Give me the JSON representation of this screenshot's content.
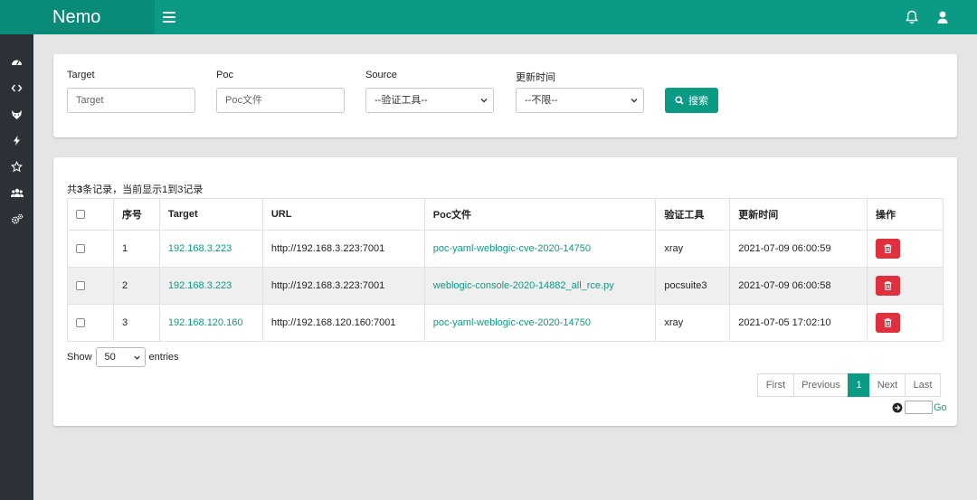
{
  "app": {
    "brand": "Nemo",
    "accent": "#0b9b84",
    "sidebar_bg": "#2b3136",
    "danger": "#e0303e"
  },
  "topbar": {
    "menu_icon": "hamburger-icon",
    "notification_icon": "bell-icon",
    "user_icon": "user-icon"
  },
  "sidebar": {
    "items": [
      {
        "icon": "dashboard-icon"
      },
      {
        "icon": "code-icon"
      },
      {
        "icon": "fox-icon"
      },
      {
        "icon": "bolt-icon"
      },
      {
        "icon": "star-icon"
      },
      {
        "icon": "users-icon"
      },
      {
        "icon": "gears-icon"
      }
    ]
  },
  "search": {
    "target_label": "Target",
    "target_placeholder": "Target",
    "poc_label": "Poc",
    "poc_placeholder": "Poc文件",
    "source_label": "Source",
    "source_selected": "--验证工具--",
    "time_label": "更新时间",
    "time_selected": "--不限--",
    "button_label": "搜索"
  },
  "table": {
    "summary_prefix": "共",
    "summary_count": "3",
    "summary_suffix": "条记录，当前显示1到3记录",
    "headers": [
      "",
      "序号",
      "Target",
      "URL",
      "Poc文件",
      "验证工具",
      "更新时间",
      "操作"
    ],
    "rows": [
      {
        "index": "1",
        "target": "192.168.3.223",
        "url": "http://192.168.3.223:7001",
        "poc": "poc-yaml-weblogic-cve-2020-14750",
        "tool": "xray",
        "time": "2021-07-09 06:00:59"
      },
      {
        "index": "2",
        "target": "192.168.3.223",
        "url": "http://192.168.3.223:7001",
        "poc": "weblogic-console-2020-14882_all_rce.py",
        "tool": "pocsuite3",
        "time": "2021-07-09 06:00:58"
      },
      {
        "index": "3",
        "target": "192.168.120.160",
        "url": "http://192.168.120.160:7001",
        "poc": "poc-yaml-weblogic-cve-2020-14750",
        "tool": "xray",
        "time": "2021-07-05 17:02:10"
      }
    ]
  },
  "length": {
    "show_label": "Show",
    "value": "50",
    "entries_label": "entries"
  },
  "pagination": {
    "first": "First",
    "previous": "Previous",
    "current": "1",
    "next": "Next",
    "last": "Last"
  },
  "goto": {
    "go_label": "Go"
  }
}
